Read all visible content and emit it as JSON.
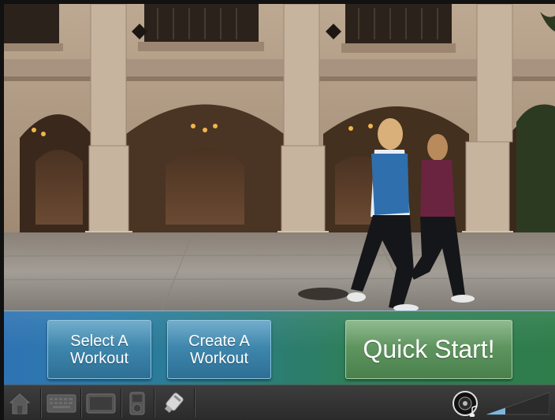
{
  "actions": {
    "select_workout_line1": "Select A",
    "select_workout_line2": "Workout",
    "create_workout_line1": "Create A",
    "create_workout_line2": "Workout",
    "quick_start": "Quick Start!"
  },
  "taskbar": {
    "icons": [
      "home-icon",
      "keyboard-icon",
      "display-icon",
      "media-player-icon",
      "usb-drive-icon",
      "speaker-icon",
      "volume-level-indicator"
    ],
    "volume_level": 0.3
  },
  "colors": {
    "blue_button": "#3f87ad",
    "green_button": "#5f955f",
    "taskbar": "#333333"
  }
}
